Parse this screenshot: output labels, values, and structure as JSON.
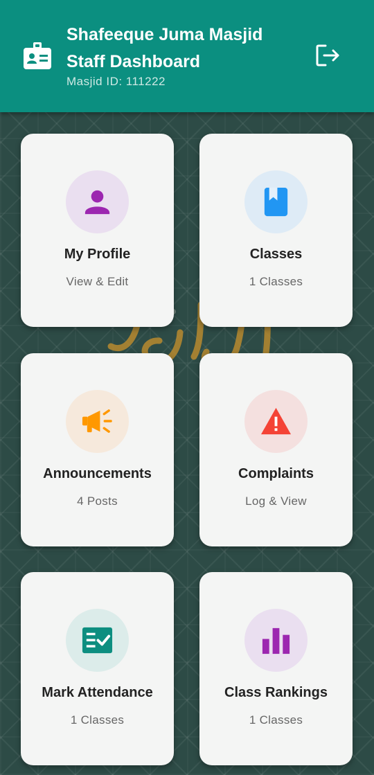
{
  "header": {
    "title_line1": "Shafeeque Juma Masjid",
    "title_line2": "Staff Dashboard",
    "masjid_id": "Masjid ID: 111222",
    "background_color": "#0b8f80"
  },
  "cards": [
    {
      "title": "My Profile",
      "subtitle": "View & Edit",
      "icon": "person-icon",
      "icon_color": "#9c27b0",
      "circle_color": "#eadff0"
    },
    {
      "title": "Classes",
      "subtitle": "1 Classes",
      "icon": "book-icon",
      "icon_color": "#2196f3",
      "circle_color": "#deebf6"
    },
    {
      "title": "Announcements",
      "subtitle": "4 Posts",
      "icon": "megaphone-icon",
      "icon_color": "#ff9800",
      "circle_color": "#f6e9dc"
    },
    {
      "title": "Complaints",
      "subtitle": "Log & View",
      "icon": "warning-icon",
      "icon_color": "#f44336",
      "circle_color": "#f4e0df"
    },
    {
      "title": "Mark Attendance",
      "subtitle": "1 Classes",
      "icon": "attendance-checklist-icon",
      "icon_color": "#0d8e80",
      "circle_color": "#dcecea"
    },
    {
      "title": "Class Rankings",
      "subtitle": "1 Classes",
      "icon": "bar-chart-icon",
      "icon_color": "#9c27b0",
      "circle_color": "#eadff0"
    }
  ]
}
